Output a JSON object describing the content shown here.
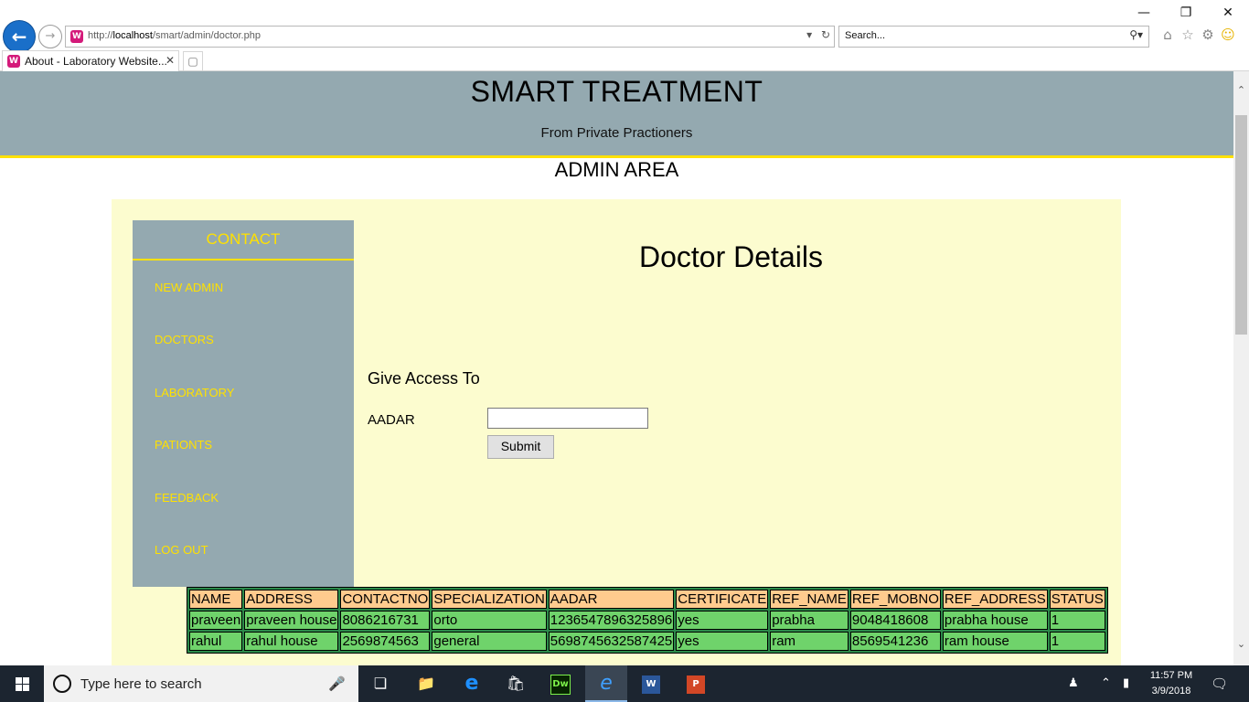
{
  "browser": {
    "url_prefix": "http://",
    "url_host": "localhost",
    "url_path": "/smart/admin/doctor.php",
    "search_placeholder": "Search...",
    "tab_title": "About - Laboratory Website...",
    "favicon_letter": "W"
  },
  "site": {
    "title": "SMART TREATMENT",
    "subtitle": "From Private Practioners",
    "area": "ADMIN AREA",
    "header_color": "#94a9b0",
    "accent_color": "#ffe100",
    "content_bg": "#fcfccf"
  },
  "sidebar": {
    "heading": "CONTACT",
    "items": [
      {
        "label": "NEW ADMIN"
      },
      {
        "label": "DOCTORS"
      },
      {
        "label": "LABORATORY"
      },
      {
        "label": "PATIONTS"
      },
      {
        "label": "FEEDBACK"
      },
      {
        "label": "LOG OUT"
      }
    ]
  },
  "main": {
    "title": "Doctor Details",
    "form": {
      "heading": "Give Access To",
      "aadar_label": "AADAR",
      "aadar_value": "",
      "submit_label": "Submit"
    },
    "table": {
      "columns": [
        "NAME",
        "ADDRESS",
        "CONTACTNO",
        "SPECIALIZATION",
        "AADAR",
        "CERTIFICATE",
        "REF_NAME",
        "REF_MOBNO",
        "REF_ADDRESS",
        "STATUS"
      ],
      "rows": [
        [
          "praveen",
          "praveen house",
          "8086216731",
          "orto",
          "1236547896325896",
          "yes",
          "prabha",
          "9048418608",
          "prabha house",
          "1"
        ],
        [
          "rahul",
          "rahul house",
          "2569874563",
          "general",
          "5698745632587425",
          "yes",
          "ram",
          "8569541236",
          "ram house",
          "1"
        ]
      ]
    }
  },
  "taskbar": {
    "search_placeholder": "Type here to search",
    "time": "11:57 PM",
    "date": "3/9/2018"
  }
}
